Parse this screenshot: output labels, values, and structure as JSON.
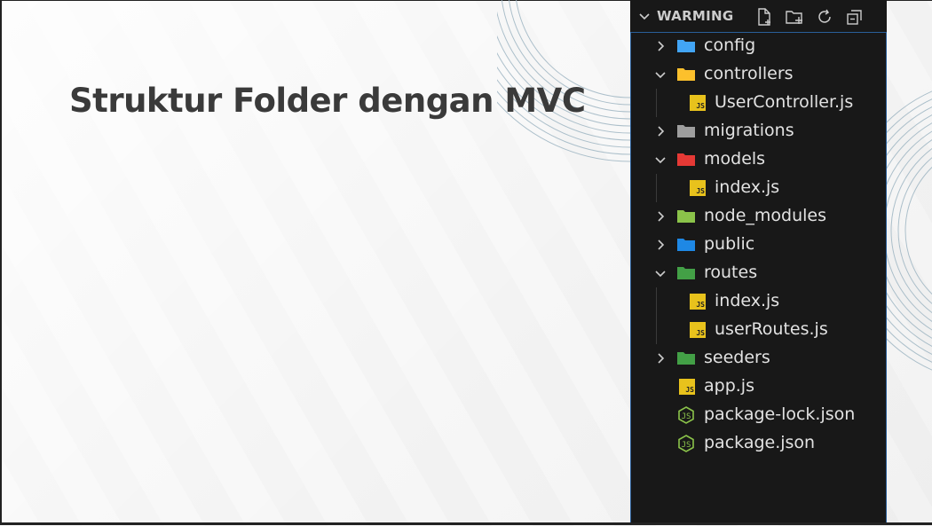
{
  "slide": {
    "title": "Struktur Folder dengan MVC"
  },
  "explorer": {
    "section_title": "WARMING",
    "actions": [
      {
        "name": "new-file-icon"
      },
      {
        "name": "new-folder-icon"
      },
      {
        "name": "refresh-icon"
      },
      {
        "name": "collapse-all-icon"
      }
    ],
    "items": [
      {
        "label": "config",
        "type": "folder",
        "expanded": false,
        "depth": 0,
        "icon": "config-folder-icon",
        "color": "#42a5f5"
      },
      {
        "label": "controllers",
        "type": "folder",
        "expanded": true,
        "depth": 0,
        "icon": "controllers-folder-icon",
        "color": "#fbc02d"
      },
      {
        "label": "UserController.js",
        "type": "file",
        "depth": 1,
        "icon": "js-file-icon"
      },
      {
        "label": "migrations",
        "type": "folder",
        "expanded": false,
        "depth": 0,
        "icon": "folder-icon",
        "color": "#9e9e9e"
      },
      {
        "label": "models",
        "type": "folder",
        "expanded": true,
        "depth": 0,
        "icon": "models-folder-icon",
        "color": "#e53935"
      },
      {
        "label": "index.js",
        "type": "file",
        "depth": 1,
        "icon": "js-file-icon"
      },
      {
        "label": "node_modules",
        "type": "folder",
        "expanded": false,
        "depth": 0,
        "icon": "node-modules-folder-icon",
        "color": "#8bc34a"
      },
      {
        "label": "public",
        "type": "folder",
        "expanded": false,
        "depth": 0,
        "icon": "public-folder-icon",
        "color": "#1e88e5"
      },
      {
        "label": "routes",
        "type": "folder",
        "expanded": true,
        "depth": 0,
        "icon": "routes-folder-icon",
        "color": "#43a047"
      },
      {
        "label": "index.js",
        "type": "file",
        "depth": 1,
        "icon": "js-file-icon"
      },
      {
        "label": "userRoutes.js",
        "type": "file",
        "depth": 1,
        "icon": "js-file-icon"
      },
      {
        "label": "seeders",
        "type": "folder",
        "expanded": false,
        "depth": 0,
        "icon": "seeders-folder-icon",
        "color": "#43a047"
      },
      {
        "label": "app.js",
        "type": "file",
        "depth": 0,
        "icon": "js-file-icon"
      },
      {
        "label": "package-lock.json",
        "type": "file",
        "depth": 0,
        "icon": "nodejs-file-icon"
      },
      {
        "label": "package.json",
        "type": "file",
        "depth": 0,
        "icon": "nodejs-file-icon"
      }
    ]
  },
  "colors": {
    "title": "#3a3a3a",
    "panel_bg": "#181818",
    "focus_border": "#2a5f9a",
    "js_badge": "#e8c21c",
    "node_green": "#8bc34a",
    "ring_line": "#9fb6c3"
  }
}
